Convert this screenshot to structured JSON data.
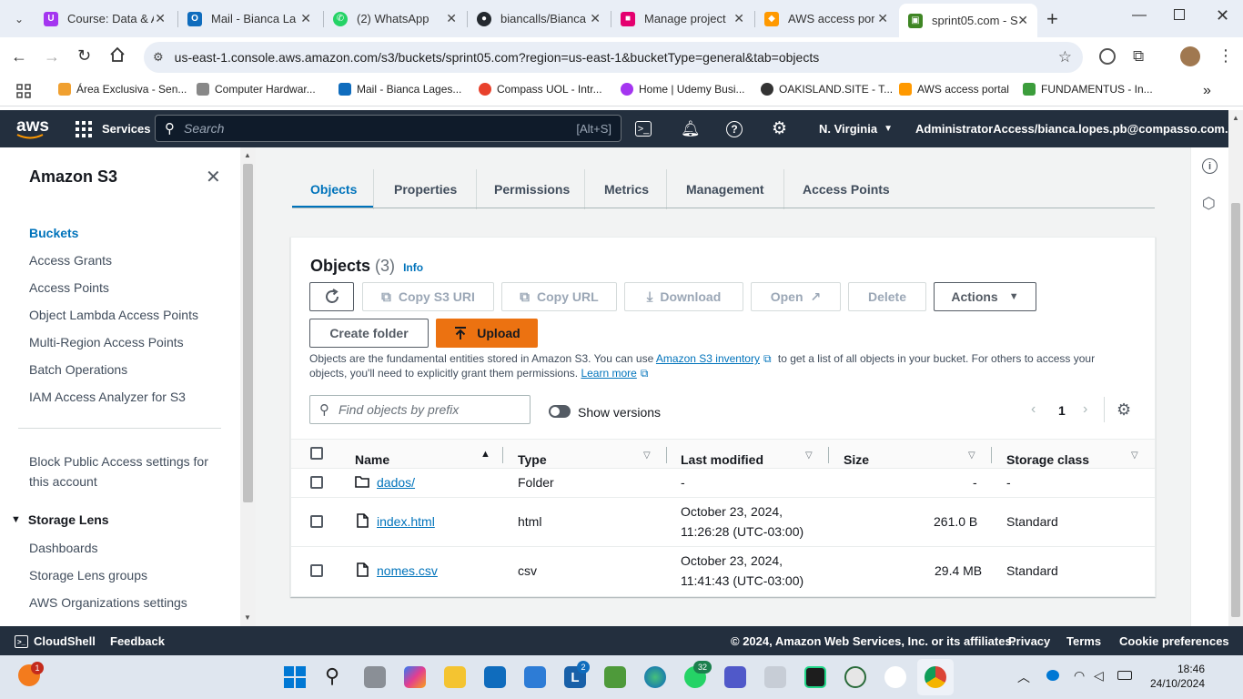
{
  "browser": {
    "tabs": [
      {
        "title": "Course: Data & A",
        "color": "#a435f0"
      },
      {
        "title": "Mail - Bianca La",
        "color": "#0f6cbd"
      },
      {
        "title": "(2) WhatsApp",
        "color": "#25d366"
      },
      {
        "title": "biancalls/Bianca",
        "color": "#24292f"
      },
      {
        "title": "Manage project",
        "color": "#e4006f"
      },
      {
        "title": "AWS access port",
        "color": "#ff9900"
      },
      {
        "title": "sprint05.com - S",
        "color": "#3f8624"
      }
    ],
    "url": "us-east-1.console.aws.amazon.com/s3/buckets/sprint05.com?region=us-east-1&bucketType=general&tab=objects",
    "bookmarks": [
      "Área Exclusiva - Sen...",
      "Computer Hardwar...",
      "Mail - Bianca Lages...",
      "Compass UOL - Intr...",
      "Home | Udemy Busi...",
      "OAKISLAND.SITE - T...",
      "AWS access portal",
      "FUNDAMENTUS - In..."
    ]
  },
  "aws_header": {
    "logo": "aws",
    "services": "Services",
    "search_placeholder": "Search",
    "search_shortcut": "[Alt+S]",
    "region": "N. Virginia",
    "account": "AdministratorAccess/bianca.lopes.pb@compasso.com.br"
  },
  "sidenav": {
    "title": "Amazon S3",
    "items": [
      "Buckets",
      "Access Grants",
      "Access Points",
      "Object Lambda Access Points",
      "Multi-Region Access Points",
      "Batch Operations",
      "IAM Access Analyzer for S3"
    ],
    "block_public_line1": "Block Public Access settings for",
    "block_public_line2": "this account",
    "storage_lens": "Storage Lens",
    "lens_items": [
      "Dashboards",
      "Storage Lens groups",
      "AWS Organizations settings"
    ]
  },
  "tabs": [
    "Objects",
    "Properties",
    "Permissions",
    "Metrics",
    "Management",
    "Access Points"
  ],
  "objects": {
    "title": "Objects",
    "count": "(3)",
    "info": "Info",
    "buttons": {
      "copy_uri": "Copy S3 URI",
      "copy_url": "Copy URL",
      "download": "Download",
      "open": "Open",
      "delete": "Delete",
      "actions": "Actions",
      "create_folder": "Create folder",
      "upload": "Upload"
    },
    "desc_1": "Objects are the fundamental entities stored in Amazon S3. You can use",
    "desc_link": "Amazon S3 inventory",
    "desc_2": "to get a list of all objects in your bucket. For others to access your",
    "desc_3": "objects, you'll need to explicitly grant them permissions.",
    "learn_more": "Learn more",
    "filter_placeholder": "Find objects by prefix",
    "show_versions": "Show versions",
    "page": "1",
    "columns": [
      "Name",
      "Type",
      "Last modified",
      "Size",
      "Storage class"
    ],
    "rows": [
      {
        "name": "dados/",
        "type": "Folder",
        "modified_1": "-",
        "modified_2": "",
        "size": "-",
        "storage": "-",
        "icon": "folder-icon"
      },
      {
        "name": "index.html",
        "type": "html",
        "modified_1": "October 23, 2024,",
        "modified_2": "11:26:28 (UTC-03:00)",
        "size": "261.0 B",
        "storage": "Standard",
        "icon": "file-icon"
      },
      {
        "name": "nomes.csv",
        "type": "csv",
        "modified_1": "October 23, 2024,",
        "modified_2": "11:41:43 (UTC-03:00)",
        "size": "29.4 MB",
        "storage": "Standard",
        "icon": "file-icon"
      }
    ]
  },
  "footer": {
    "cloudshell": "CloudShell",
    "feedback": "Feedback",
    "copyright": "© 2024, Amazon Web Services, Inc. or its affiliates.",
    "privacy": "Privacy",
    "terms": "Terms",
    "cookies": "Cookie preferences"
  },
  "taskbar": {
    "time": "18:46",
    "date": "24/10/2024",
    "badges": {
      "notify": "1",
      "teams_count": "2",
      "whatsapp_count": "32"
    }
  }
}
